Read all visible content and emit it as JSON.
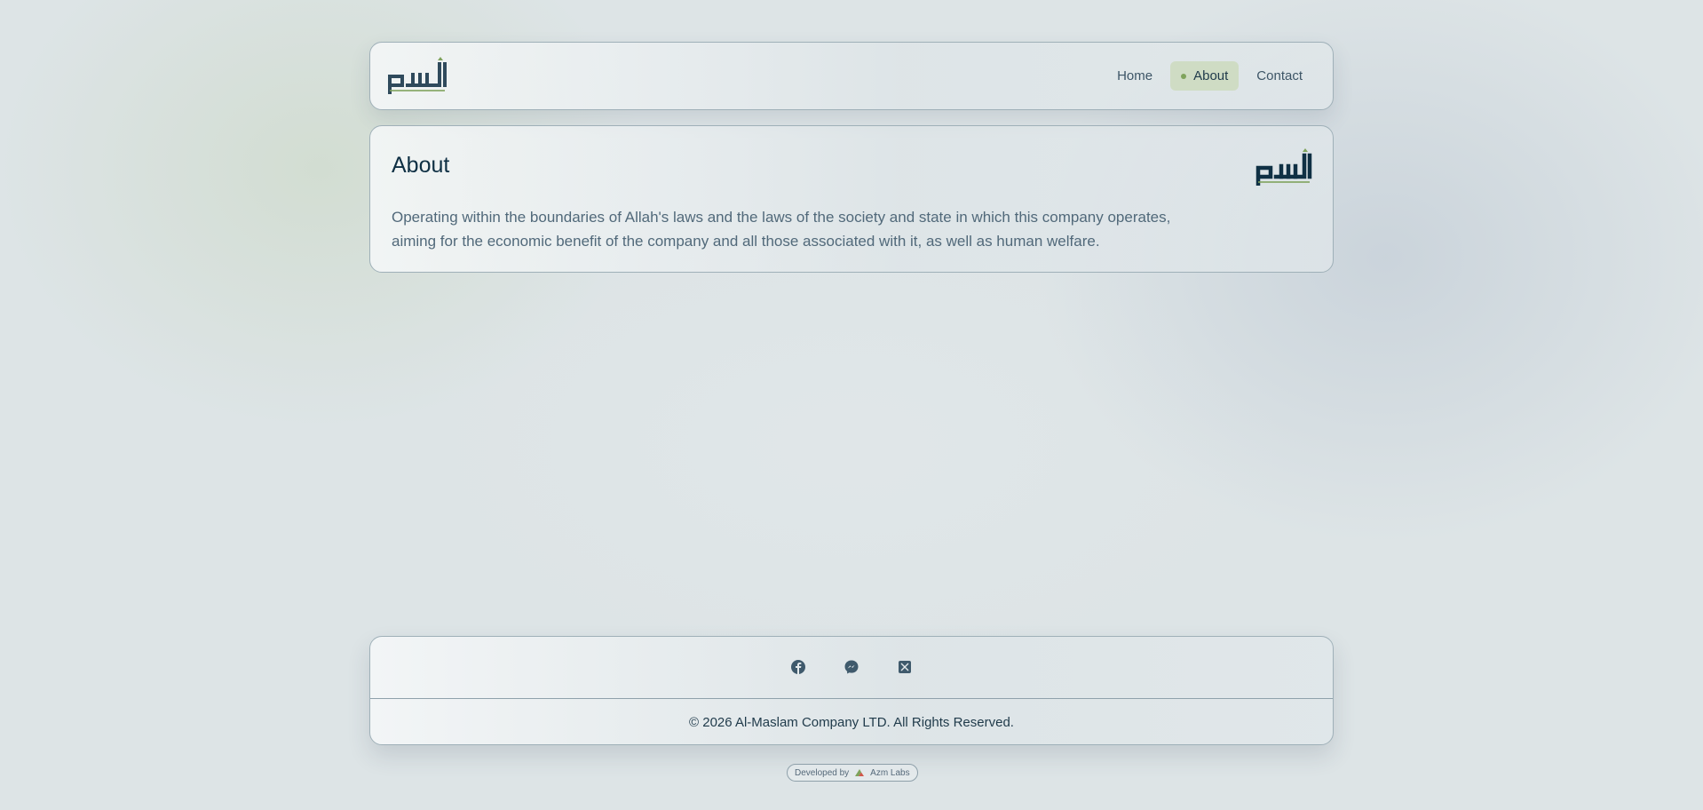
{
  "header": {
    "logo_alt": "Al-Maslam logo",
    "nav": [
      {
        "label": "Home",
        "active": false
      },
      {
        "label": "About",
        "active": true
      },
      {
        "label": "Contact",
        "active": false
      }
    ]
  },
  "main": {
    "title": "About",
    "body_line_1": "Operating within the boundaries of Allah's laws and the laws of the society and state in which this company operates,",
    "body_line_2": "aiming for the economic benefit of the company and all those associated with it, as well as human welfare."
  },
  "footer": {
    "social": [
      {
        "icon": "facebook-icon"
      },
      {
        "icon": "messenger-icon"
      },
      {
        "icon": "x-twitter-icon"
      }
    ],
    "copyright": "© 2026 Al-Maslam Company LTD. All Rights Reserved."
  },
  "dev_badge": {
    "prefix": "Developed by",
    "name": "Azm Labs"
  },
  "colors": {
    "brand_dark": "#0f3044",
    "brand_green": "#7fa35c",
    "active_nav_bg": "#cfdcc4",
    "page_bg": "#dde4e6"
  }
}
